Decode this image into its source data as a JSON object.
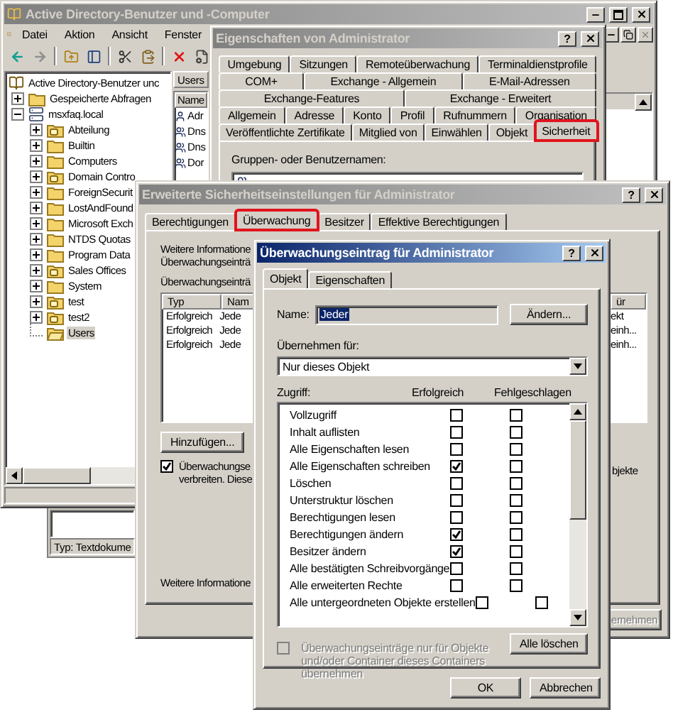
{
  "explorer": {
    "title": "Active Directory-Benutzer und -Computer",
    "active": false,
    "menu": [
      "Datei",
      "Aktion",
      "Ansicht",
      "Fenster"
    ],
    "tree": [
      {
        "label": "Active Directory-Benutzer unc",
        "kind": "directory",
        "selected": false,
        "children": [
          {
            "label": "Gespeicherte Abfragen",
            "kind": "folder",
            "expanded": false,
            "selected": false
          },
          {
            "label": "msxfaq.local",
            "kind": "domain",
            "expanded": true,
            "selected": false,
            "children": [
              {
                "label": "Abteilung",
                "kind": "ou",
                "expanded": false,
                "selected": false
              },
              {
                "label": "Builtin",
                "kind": "folder",
                "expanded": false,
                "selected": false
              },
              {
                "label": "Computers",
                "kind": "folder",
                "expanded": false,
                "selected": false
              },
              {
                "label": "Domain Contro",
                "kind": "ou",
                "expanded": false,
                "selected": false
              },
              {
                "label": "ForeignSecurit",
                "kind": "folder",
                "expanded": false,
                "selected": false
              },
              {
                "label": "LostAndFound",
                "kind": "folder",
                "expanded": false,
                "selected": false
              },
              {
                "label": "Microsoft Exch",
                "kind": "folder",
                "expanded": false,
                "selected": false
              },
              {
                "label": "NTDS Quotas",
                "kind": "folder",
                "expanded": false,
                "selected": false
              },
              {
                "label": "Program Data",
                "kind": "folder",
                "expanded": false,
                "selected": false
              },
              {
                "label": "Sales Offices",
                "kind": "ou",
                "expanded": false,
                "selected": false
              },
              {
                "label": "System",
                "kind": "folder",
                "expanded": false,
                "selected": false
              },
              {
                "label": "test",
                "kind": "ou",
                "expanded": false,
                "selected": false
              },
              {
                "label": "test2",
                "kind": "ou",
                "expanded": false,
                "selected": false
              },
              {
                "label": "Users",
                "kind": "folder-open",
                "selected": true
              }
            ]
          }
        ]
      }
    ],
    "list_tab": "Users",
    "list_column": "Name",
    "list_rows": [
      {
        "label": "Adr",
        "kind": "user"
      },
      {
        "label": "Dns",
        "kind": "group"
      },
      {
        "label": "Dns",
        "kind": "group"
      },
      {
        "label": "Dor",
        "kind": "group"
      }
    ]
  },
  "document_window": {
    "status": "Typ: Textdokume"
  },
  "properties": {
    "title": "Eigenschaften von Administrator",
    "active": false,
    "help": "?",
    "tab_rows": [
      [
        {
          "label": "Umgebung",
          "selected": false,
          "marked": false
        },
        {
          "label": "Sitzungen",
          "selected": false,
          "marked": false
        },
        {
          "label": "Remoteüberwachung",
          "selected": false,
          "marked": false
        },
        {
          "label": "Terminaldienstprofile",
          "selected": false,
          "marked": false
        }
      ],
      [
        {
          "label": "COM+",
          "selected": false,
          "marked": false
        },
        {
          "label": "Exchange - Allgemein",
          "selected": false,
          "marked": false
        },
        {
          "label": "E-Mail-Adressen",
          "selected": false,
          "marked": false
        }
      ],
      [
        {
          "label": "Exchange-Features",
          "selected": false,
          "marked": false
        },
        {
          "label": "Exchange - Erweitert",
          "selected": false,
          "marked": false
        }
      ],
      [
        {
          "label": "Allgemein",
          "selected": false,
          "marked": false
        },
        {
          "label": "Adresse",
          "selected": false,
          "marked": false
        },
        {
          "label": "Konto",
          "selected": false,
          "marked": false
        },
        {
          "label": "Profil",
          "selected": false,
          "marked": false
        },
        {
          "label": "Rufnummern",
          "selected": false,
          "marked": false
        },
        {
          "label": "Organisation",
          "selected": false,
          "marked": false
        }
      ],
      [
        {
          "label": "Veröffentlichte Zertifikate",
          "selected": false,
          "marked": false
        },
        {
          "label": "Mitglied von",
          "selected": false,
          "marked": false
        },
        {
          "label": "Einwählen",
          "selected": false,
          "marked": false
        },
        {
          "label": "Objekt",
          "selected": false,
          "marked": false
        },
        {
          "label": "Sicherheit",
          "selected": true,
          "marked": true
        }
      ]
    ],
    "group_label": "Gruppen- oder Benutzernamen:"
  },
  "advanced": {
    "title": "Erweiterte Sicherheitseinstellungen für Administrator",
    "active": false,
    "help": "?",
    "tabs": [
      {
        "label": "Berechtigungen",
        "selected": false,
        "marked": false
      },
      {
        "label": "Überwachung",
        "selected": true,
        "marked": true
      },
      {
        "label": "Besitzer",
        "selected": false,
        "marked": false
      },
      {
        "label": "Effektive Berechtigungen",
        "selected": false,
        "marked": false
      }
    ],
    "intro_lines": [
      "Weitere Informatione",
      "Überwachungseinträ"
    ],
    "list_label": "Überwachungseinträ",
    "columns": [
      "Typ",
      "Nam"
    ],
    "right_column": "ür",
    "rows": [
      {
        "cells": [
          "Erfolgreich",
          "Jede"
        ],
        "right": "ekt"
      },
      {
        "cells": [
          "Erfolgreich",
          "Jede"
        ],
        "right": "einh..."
      },
      {
        "cells": [
          "Erfolgreich",
          "Jede"
        ],
        "right": "einh..."
      }
    ],
    "add_button": "Hinzufügen...",
    "inherit": {
      "checked": true,
      "lines": [
        "Überwachungse",
        "verbreiten. Diese"
      ],
      "right": "bjekte"
    },
    "footer": "Weitere Informatione",
    "apply_button": {
      "label": "ernehmen",
      "disabled": true
    }
  },
  "entry": {
    "title": "Überwachungseintrag für Administrator",
    "active": true,
    "help": "?",
    "tabs": [
      {
        "label": "Objekt",
        "selected": true
      },
      {
        "label": "Eigenschaften",
        "selected": false
      }
    ],
    "name_label": "Name:",
    "name_value": "Jeder",
    "change_button": "Ändern...",
    "apply_label": "Übernehmen für:",
    "apply_value": "Nur dieses Objekt",
    "access_label": "Zugriff:",
    "columns": [
      "Erfolgreich",
      "Fehlgeschlagen"
    ],
    "rows": [
      {
        "label": "Vollzugriff",
        "success": false,
        "failure": false
      },
      {
        "label": "Inhalt auflisten",
        "success": false,
        "failure": false
      },
      {
        "label": "Alle Eigenschaften lesen",
        "success": false,
        "failure": false
      },
      {
        "label": "Alle Eigenschaften schreiben",
        "success": true,
        "failure": false
      },
      {
        "label": "Löschen",
        "success": false,
        "failure": false
      },
      {
        "label": "Unterstruktur löschen",
        "success": false,
        "failure": false
      },
      {
        "label": "Berechtigungen lesen",
        "success": false,
        "failure": false
      },
      {
        "label": "Berechtigungen ändern",
        "success": true,
        "failure": false
      },
      {
        "label": "Besitzer ändern",
        "success": true,
        "failure": false
      },
      {
        "label": "Alle bestätigten Schreibvorgänge",
        "success": false,
        "failure": false
      },
      {
        "label": "Alle erweiterten Rechte",
        "success": false,
        "failure": false
      },
      {
        "label": "Alle untergeordneten Objekte erstellen",
        "success": false,
        "failure": false
      }
    ],
    "inherit": {
      "checked": false,
      "disabled": true,
      "label": "Überwachungseinträge nur für Objekte und/oder Container dieses Containers übernehmen"
    },
    "clear_button": "Alle löschen",
    "buttons": [
      "OK",
      "Abbrechen"
    ]
  }
}
